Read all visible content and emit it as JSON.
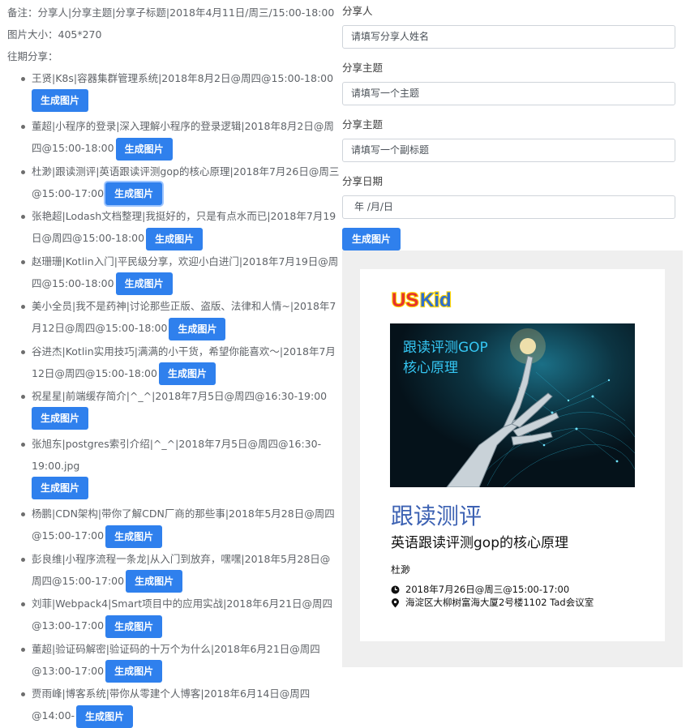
{
  "notes": {
    "remark": "备注：分享人|分享主题|分享子标题|2018年4月11日/周三/15:00-18:00",
    "image_size": "图片大小：405*270",
    "history_label": "往期分享："
  },
  "button_label": "生成图片",
  "history": [
    {
      "text": "王贤|K8s|容器集群管理系统|2018年8月2日@周四@15:00-18:00"
    },
    {
      "text": "董超|小程序的登录|深入理解小程序的登录逻辑|2018年8月2日@周四@15:00-18:00"
    },
    {
      "text": "杜渺|跟读测评|英语跟读评测gop的核心原理|2018年7月26日@周三@15:00-17:00"
    },
    {
      "text": "张艳超|Lodash文档整理|我挺好的，只是有点水而已|2018年7月19日@周四@15:00-18:00"
    },
    {
      "text": "赵珊珊|Kotlin入门|平民级分享，欢迎小白进门|2018年7月19日@周四@15:00-18:00"
    },
    {
      "text": "美小全员|我不是药神|讨论那些正版、盗版、法律和人情~|2018年7月12日@周四@15:00-18:00"
    },
    {
      "text": "谷进杰|Kotlin实用技巧|满满的小干货，希望你能喜欢～|2018年7月12日@周四@15:00-18:00"
    },
    {
      "text": "祝星星|前端缓存简介|^_^|2018年7月5日@周四@16:30-19:00"
    },
    {
      "text": "张旭东|postgres索引介绍|^_^|2018年7月5日@周四@16:30-19:00.jpg"
    },
    {
      "text": "杨鹏|CDN架构|带你了解CDN厂商的那些事|2018年5月28日@周四@15:00-17:00"
    },
    {
      "text": "彭良维|小程序流程一条龙|从入门到放弃，嘿嘿|2018年5月28日@周四@15:00-17:00"
    },
    {
      "text": "刘菲|Webpack4|Smart项目中的应用实战|2018年6月21日@周四@13:00-17:00"
    },
    {
      "text": "董超|验证码解密|验证码的十万个为什么|2018年6月21日@周四@13:00-17:00"
    },
    {
      "text": "贾雨峰|博客系统|带你从零建个人博客|2018年6月14日@周四@14:00-"
    }
  ],
  "form": {
    "speaker_label": "分享人",
    "speaker_placeholder": "请填写分享人姓名",
    "topic_label": "分享主题",
    "topic_placeholder": "请填写一个主题",
    "subtitle_label": "分享主题",
    "subtitle_placeholder": "请填写一个副标题",
    "date_label": "分享日期",
    "date_placeholder": "年 /月/日",
    "generate_label": "生成图片"
  },
  "card": {
    "logo_text": "USKid",
    "poster_line1": "跟读评测GOP",
    "poster_line2": "核心原理",
    "title": "跟读测评",
    "subtitle": "英语跟读评测gop的核心原理",
    "speaker": "杜渺",
    "time": "2018年7月26日@周三@15:00-17:00",
    "location": "海淀区大柳树富海大厦2号楼1102  Tad会议室"
  },
  "colors": {
    "primary": "#2f80ed",
    "title_blue": "#3d62b3",
    "poster_cyan": "#35c7f4"
  }
}
